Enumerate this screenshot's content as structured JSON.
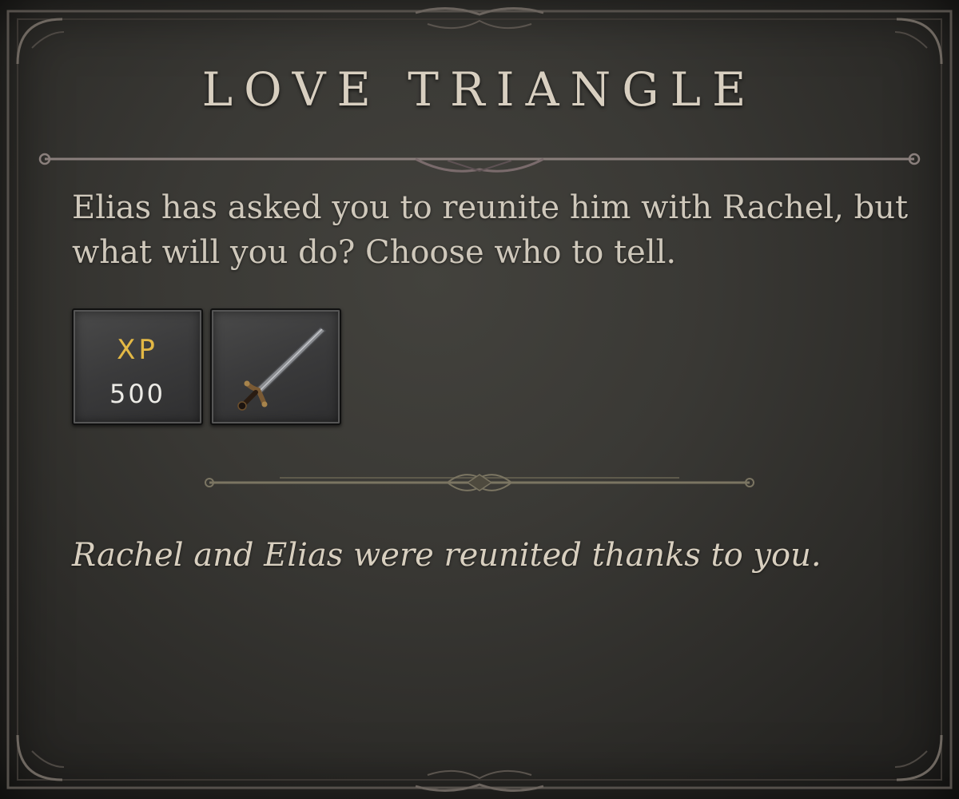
{
  "quest": {
    "title": "LOVE TRIANGLE",
    "description": "Elias has asked you to reunite him with Rachel, but what will you do? Choose who to tell.",
    "outcome": "Rachel and Elias were reunited thanks to you."
  },
  "rewards": {
    "xp_label": "XP",
    "xp_value": "500",
    "item_icon": "sword-icon"
  },
  "colors": {
    "xp_gold": "#e3b845",
    "text": "#cfc8bb",
    "frame": "#6b645e"
  }
}
